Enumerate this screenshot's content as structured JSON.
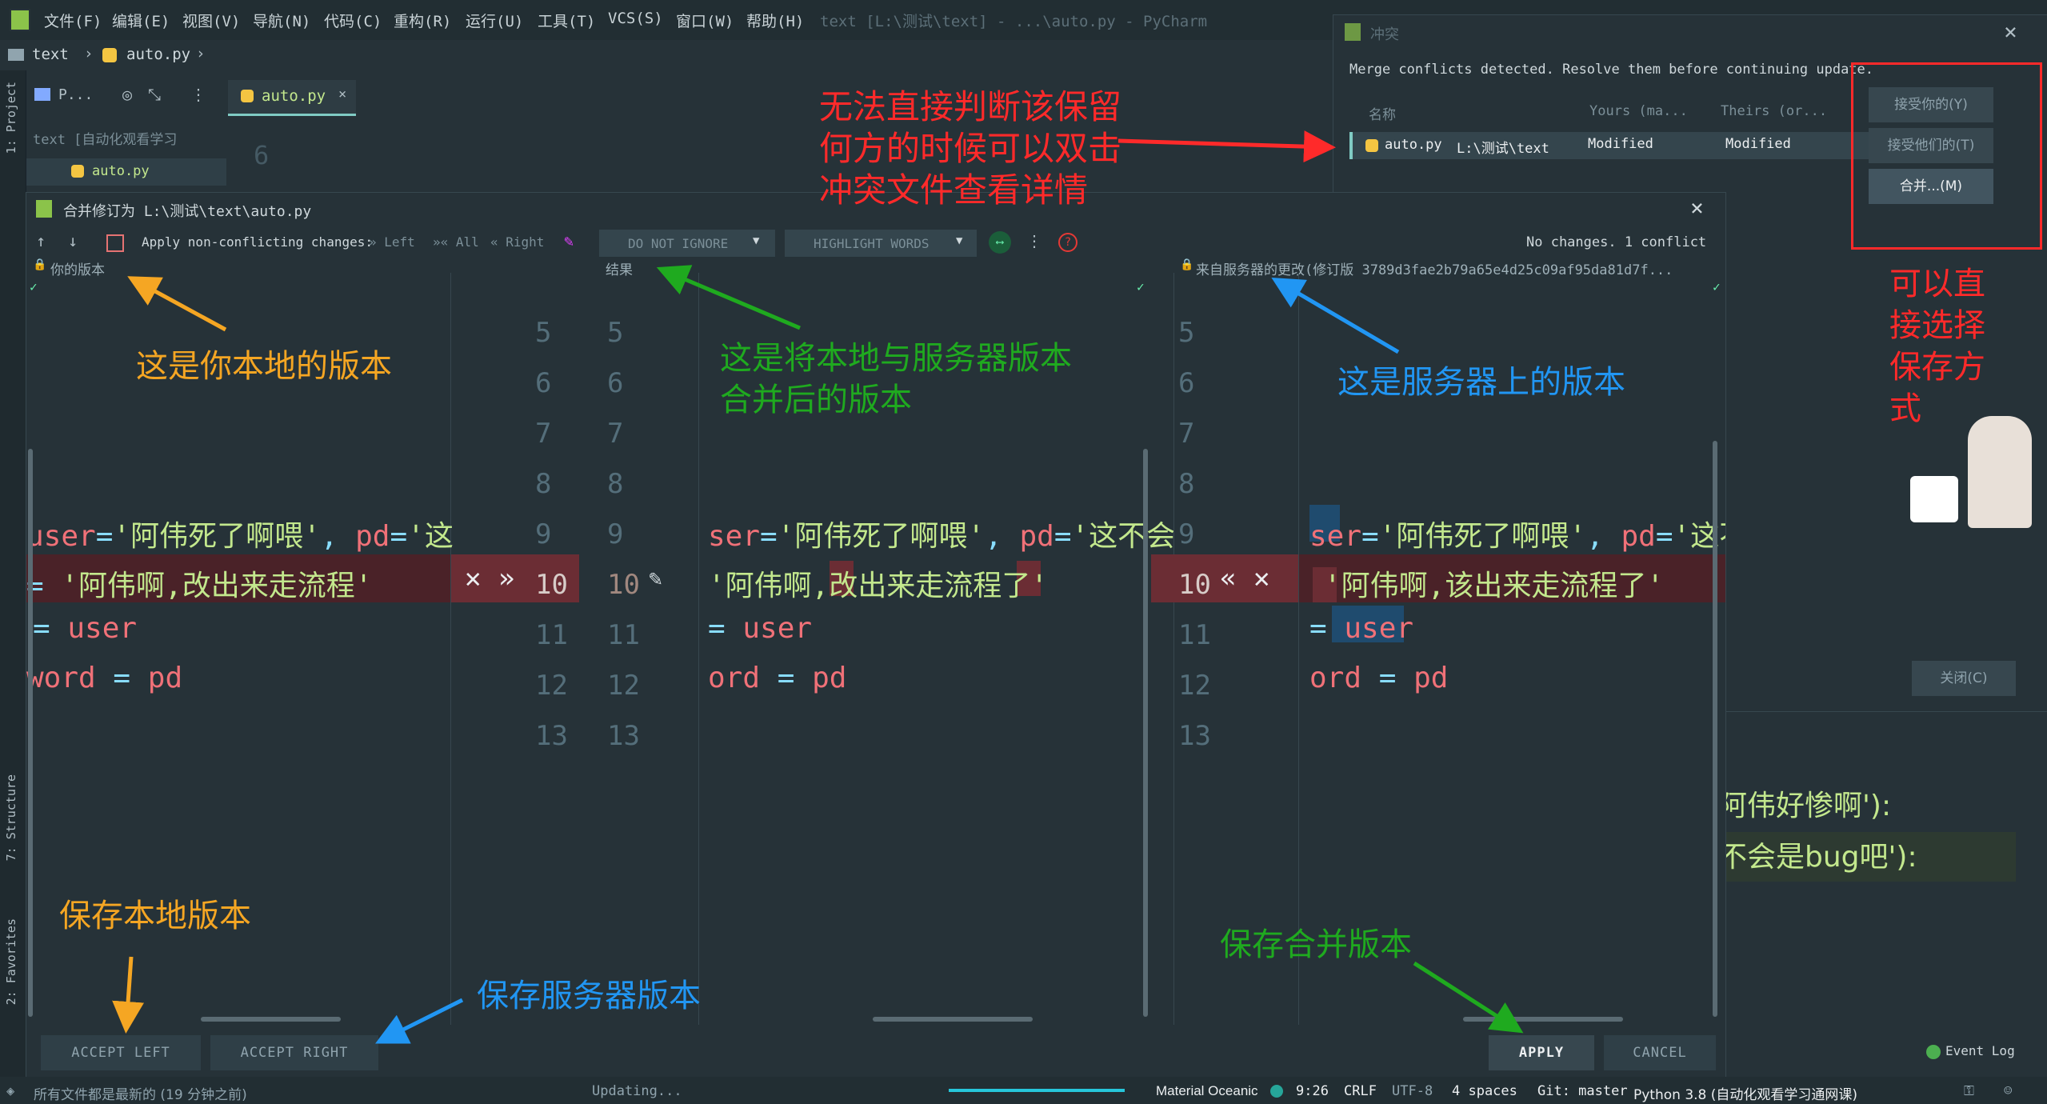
{
  "menubar": {
    "items": [
      "文件(F)",
      "编辑(E)",
      "视图(V)",
      "导航(N)",
      "代码(C)",
      "重构(R)",
      "运行(U)",
      "工具(T)",
      "VCS(S)",
      "窗口(W)",
      "帮助(H)"
    ],
    "title": "text [L:\\测试\\text] - ...\\auto.py - PyCharm"
  },
  "nav": {
    "project": "text",
    "file": "auto.py"
  },
  "project_panel": {
    "tab": "P...",
    "root": "text [自动化观看学习",
    "file": "auto.py",
    "tab_file": "auto.py",
    "line_num": "6"
  },
  "leftstrip": {
    "project": "1: Project",
    "structure": "7: Structure",
    "favorites": "2: Favorites"
  },
  "merge": {
    "title": "合并修订为 L:\\测试\\text\\auto.py",
    "apply_label": "Apply non-conflicting changes:",
    "left": "Left",
    "all": "All",
    "right": "Right",
    "ignore": "DO NOT IGNORE",
    "highlight": "HIGHLIGHT WORDS",
    "status": "No changes. 1 conflict",
    "yours": "你的版本",
    "result": "结果",
    "theirs": "来自服务器的更改(修订版 3789d3fae2b79a65e4d25c09af95da81d7f...",
    "left_nums": [
      "5",
      "6",
      "7",
      "8",
      "9",
      "10",
      "11",
      "12",
      "13"
    ],
    "mid_nums": [
      "5",
      "6",
      "7",
      "8",
      "9",
      "10",
      "11",
      "12",
      "13"
    ],
    "right_nums": [
      "5",
      "6",
      "7",
      "8",
      "9",
      "10",
      "11",
      "12",
      "13"
    ],
    "left_code": {
      "l9_a": "user",
      "l9_b": "=",
      "l9_c": "'阿伟死了啊喂'",
      "l9_d": ",",
      "l9_e": "pd",
      "l9_f": "=",
      "l9_g": "'这",
      "l10_a": "=",
      "l10_b": "'阿伟啊,改出来走流程'",
      "l11_a": "=",
      "l11_b": "user",
      "l12_a": "word",
      "l12_b": "=",
      "l12_c": "pd"
    },
    "mid_code": {
      "l9_a": "ser",
      "l9_b": "=",
      "l9_c": "'阿伟死了啊喂'",
      "l9_d": ",",
      "l9_e": "pd",
      "l9_f": "=",
      "l9_g": "'这不会",
      "l10_a": "'阿伟啊,",
      "l10_hi": "改",
      "l10_b": "出来走流程",
      "l10_hi2": "了",
      "l10_c": "'",
      "l11_a": "=",
      "l11_b": "user",
      "l12_a": "ord",
      "l12_b": "=",
      "l12_c": "pd"
    },
    "right_code": {
      "l9_a": "ser",
      "l9_b": "=",
      "l9_c": "'阿伟死了啊喂'",
      "l9_d": ",",
      "l9_e": "pd",
      "l9_f": "=",
      "l9_g": "'这不",
      "l10_a": "'阿伟啊,",
      "l10_hi": "该",
      "l10_b": "出来走流程了'",
      "l11_a": "=",
      "l11_b": "user",
      "l12_a": "ord",
      "l12_b": "=",
      "l12_c": "pd"
    },
    "buttons": {
      "accept_left": "ACCEPT LEFT",
      "accept_right": "ACCEPT RIGHT",
      "apply": "APPLY",
      "cancel": "CANCEL"
    }
  },
  "conflicts": {
    "title": "冲突",
    "message": "Merge conflicts detected. Resolve them before continuing update.",
    "cols": [
      "名称",
      "Yours (ma...",
      "Theirs (or..."
    ],
    "row": {
      "file": "auto.py",
      "path": "L:\\测试\\text",
      "yours": "Modified",
      "theirs": "Modified"
    },
    "buttons": {
      "accept_yours": "接受你的(Y)",
      "accept_theirs": "接受他们的(T)",
      "merge": "合并...(M)",
      "close": "关闭(C)"
    }
  },
  "background_code": {
    "l1": "阿伟好惨啊'):",
    "l2": "不会是bug吧'):"
  },
  "annotations": {
    "a1": "无法直接判断该保留",
    "a2": "何方的时候可以双击",
    "a3": "冲突文件查看详情",
    "local": "这是你本地的版本",
    "merged1": "这是将本地与服务器版本",
    "merged2": "合并后的版本",
    "server": "这是服务器上的版本",
    "direct1": "可以直",
    "direct2": "接选择",
    "direct3": "保存方",
    "direct4": "式",
    "save_local": "保存本地版本",
    "save_server": "保存服务器版本",
    "save_merged": "保存合并版本"
  },
  "statusbar": {
    "left": "所有文件都是最新的 (19 分钟之前)",
    "updating": "Updating...",
    "theme": "Material Oceanic",
    "pos": "9:26",
    "eol": "CRLF",
    "enc": "UTF-8",
    "indent": "4 spaces",
    "git": "Git: master",
    "python": "Python 3.8 (自动化观看学习通网课)",
    "eventlog": "Event Log"
  },
  "colors": {
    "orange": "#f5a623",
    "green": "#1faa1f",
    "blue": "#2196f3",
    "red": "#ff2a2a",
    "conflict_bg": "#4a2228",
    "accent": "#80cbc4"
  }
}
